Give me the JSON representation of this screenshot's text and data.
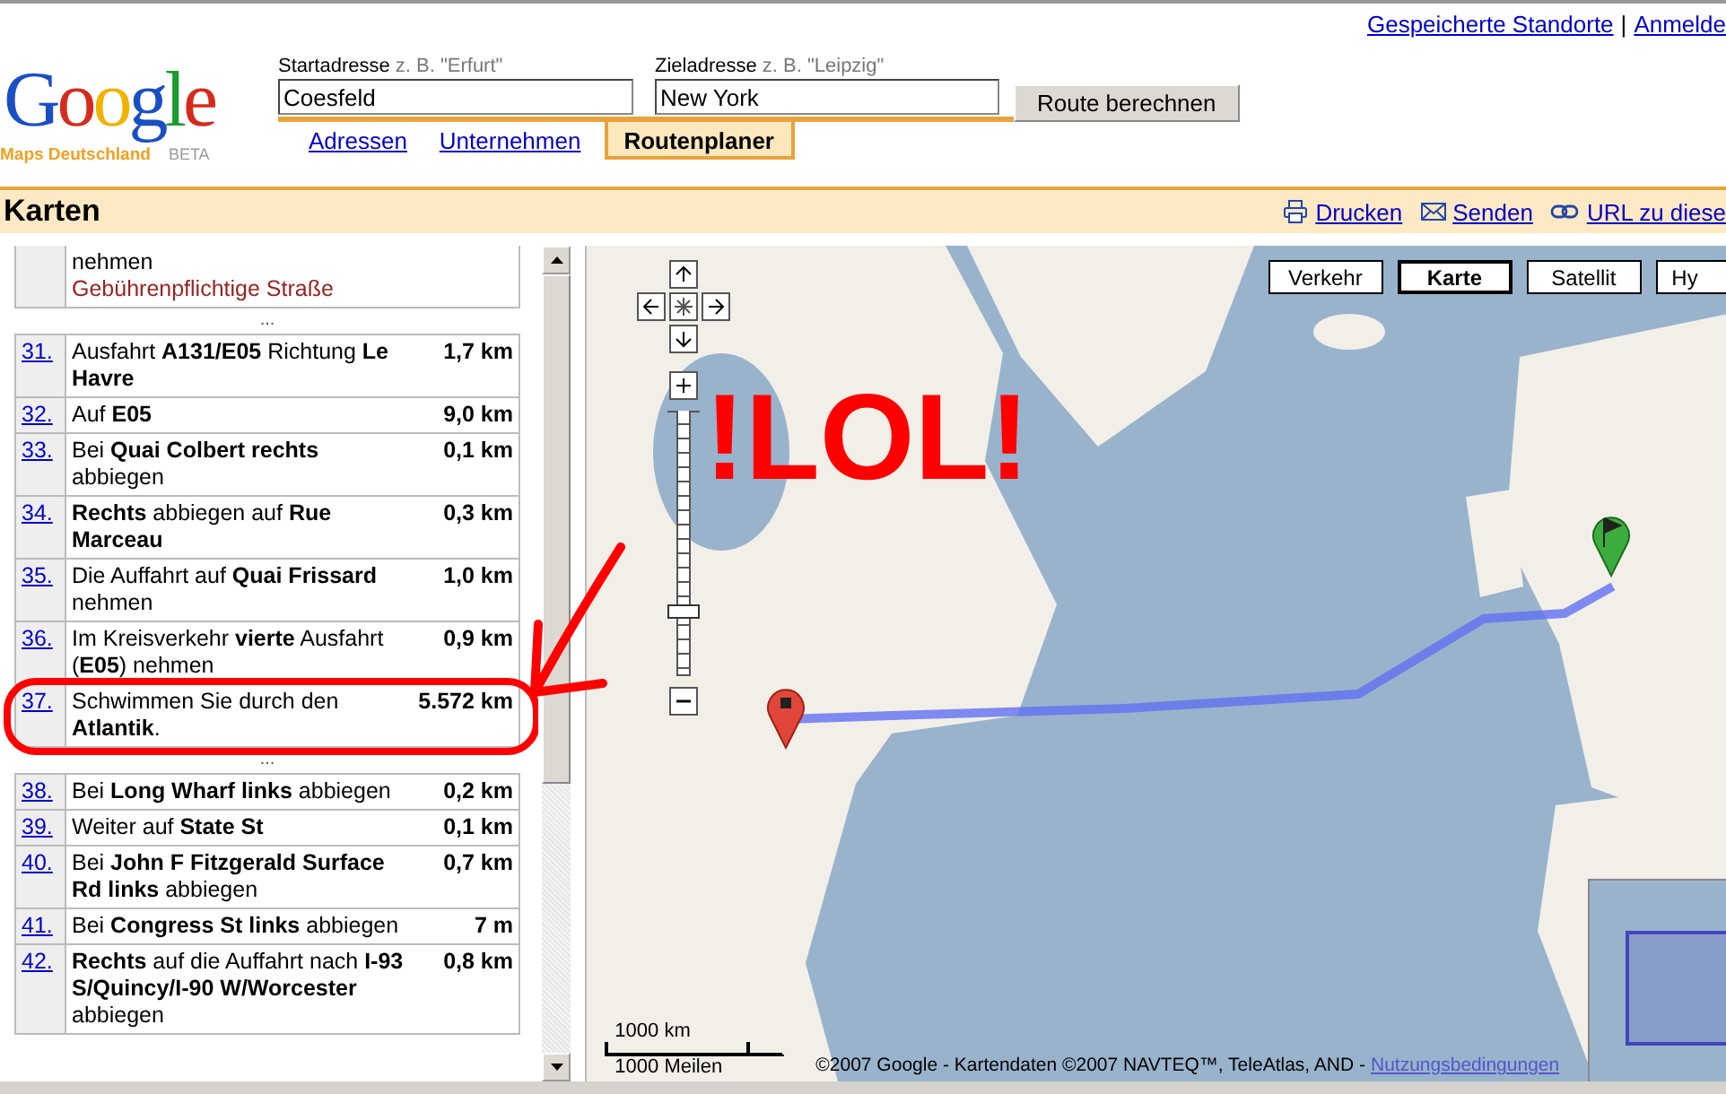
{
  "top_links": {
    "items": [
      {
        "label": "Gespeicherte Standorte"
      },
      {
        "label": "Anmelde"
      }
    ],
    "separator": "|"
  },
  "logo": {
    "word": "Google",
    "subtitle": "Maps Deutschland",
    "badge": "BETA"
  },
  "route_form": {
    "start": {
      "label": "Startadresse",
      "hint": "z. B. \"Erfurt\"",
      "value": "Coesfeld"
    },
    "end": {
      "label": "Zieladresse",
      "hint": "z. B. \"Leipzig\"",
      "value": "New York"
    },
    "submit": "Route berechnen"
  },
  "tabs": [
    {
      "label": "Adressen",
      "selected": false
    },
    {
      "label": "Unternehmen",
      "selected": false
    },
    {
      "label": "Routenplaner",
      "selected": true
    }
  ],
  "toolbar": {
    "title": "Karten",
    "actions": [
      {
        "label": "Drucken"
      },
      {
        "label": "Senden"
      },
      {
        "label": "URL zu diese"
      }
    ]
  },
  "directions": [
    {
      "kind": "step",
      "text": "nehmen",
      "note": "Gebührenpflichtige Straße",
      "circled": false
    },
    {
      "kind": "gap",
      "text": "..."
    },
    {
      "kind": "step",
      "number": "31.",
      "text": "Ausfahrt **A131/E05** Richtung **Le Havre**",
      "distance": "1,7 km",
      "circled": false
    },
    {
      "kind": "step",
      "number": "32.",
      "text": "Auf **E05**",
      "distance": "9,0 km",
      "circled": false
    },
    {
      "kind": "step",
      "number": "33.",
      "text": "Bei **Quai Colbert rechts** abbiegen",
      "distance": "0,1 km",
      "circled": false
    },
    {
      "kind": "step",
      "number": "34.",
      "text": "**Rechts** abbiegen auf **Rue Marceau**",
      "distance": "0,3 km",
      "circled": false
    },
    {
      "kind": "step",
      "number": "35.",
      "text": "Die Auffahrt auf **Quai Frissard** nehmen",
      "distance": "1,0 km",
      "circled": false
    },
    {
      "kind": "step",
      "number": "36.",
      "text": "Im Kreisverkehr **vierte** Ausfahrt (**E05**) nehmen",
      "distance": "0,9 km",
      "circled": false
    },
    {
      "kind": "step",
      "number": "37.",
      "text": "Schwimmen Sie durch den **Atlantik**.",
      "distance": "5.572 km",
      "circled": true
    },
    {
      "kind": "gap",
      "text": "..."
    },
    {
      "kind": "step",
      "number": "38.",
      "text": "Bei **Long Wharf links** abbiegen",
      "distance": "0,2 km",
      "circled": false
    },
    {
      "kind": "step",
      "number": "39.",
      "text": "Weiter auf **State St**",
      "distance": "0,1 km",
      "circled": false
    },
    {
      "kind": "step",
      "number": "40.",
      "text": "Bei **John F Fitzgerald Surface Rd links** abbiegen",
      "distance": "0,7 km",
      "circled": false
    },
    {
      "kind": "step",
      "number": "41.",
      "text": "Bei **Congress St links** abbiegen",
      "distance": "7 m",
      "circled": false
    },
    {
      "kind": "step",
      "number": "42.",
      "text": "**Rechts** auf die Auffahrt nach **I-93 S/Quincy/I-90 W/Worcester** abbiegen",
      "distance": "0,8 km",
      "circled": false
    }
  ],
  "map": {
    "types": [
      {
        "label": "Verkehr",
        "selected": false
      },
      {
        "label": "Karte",
        "selected": true
      },
      {
        "label": "Satellit",
        "selected": false
      },
      {
        "label": "Hy",
        "selected": false
      }
    ],
    "zoom": {
      "level": 0.24
    },
    "scale": {
      "metric": "1000 km",
      "imperial": "1000 Meilen"
    },
    "copyright": "©2007 Google - Kartendaten ©2007 NAVTEQ™, TeleAtlas, AND -",
    "terms": "Nutzungsbedingungen"
  },
  "annotation": {
    "text": "!LOL!"
  }
}
